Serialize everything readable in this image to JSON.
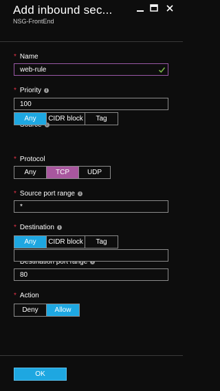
{
  "header": {
    "title": "Add inbound sec...",
    "subtitle": "NSG-FrontEnd"
  },
  "colors": {
    "background": "#0d0d0d",
    "accent_blue": "#1ea7e1",
    "accent_purple": "#a8579e",
    "required": "#e8334a",
    "valid": "#7ab648"
  },
  "form": {
    "name": {
      "label": "Name",
      "required_mark": "*",
      "value": "web-rule"
    },
    "priority": {
      "label": "Priority",
      "required_mark": "*",
      "info": "i",
      "value": "100"
    },
    "source": {
      "label": "Source",
      "required_mark": "*",
      "info": "i",
      "options": [
        "Any",
        "CIDR block",
        "Tag"
      ],
      "selected": "Any"
    },
    "protocol": {
      "label": "Protocol",
      "required_mark": "*",
      "options": [
        "Any",
        "TCP",
        "UDP"
      ],
      "selected": "TCP"
    },
    "source_port_range": {
      "label": "Source port range",
      "required_mark": "*",
      "info": "i",
      "value": "*"
    },
    "destination": {
      "label": "Destination",
      "required_mark": "*",
      "info": "i",
      "options": [
        "Any",
        "CIDR block",
        "Tag"
      ],
      "selected": "Any"
    },
    "destination_port_range": {
      "label": "Destination port range",
      "required_mark": "*",
      "info": "i",
      "value": "80"
    },
    "action": {
      "label": "Action",
      "required_mark": "*",
      "options": [
        "Deny",
        "Allow"
      ],
      "selected": "Allow"
    }
  },
  "footer": {
    "ok_label": "OK"
  }
}
